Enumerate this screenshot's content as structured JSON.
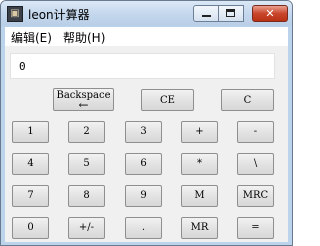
{
  "window": {
    "title": "leon计算器",
    "app_icon_glyph": "▣",
    "minimize_glyph": "",
    "close_glyph": "✕"
  },
  "menu": {
    "edit": "编辑(E)",
    "help": "帮助(H)"
  },
  "display": {
    "value": "0"
  },
  "top_buttons": {
    "backspace": "Backspace",
    "backspace_arrow": "←",
    "ce": "CE",
    "c": "C"
  },
  "keypad": {
    "rows": [
      [
        "1",
        "2",
        "3",
        "+",
        "-"
      ],
      [
        "4",
        "5",
        "6",
        "*",
        "\\"
      ],
      [
        "7",
        "8",
        "9",
        "M",
        "MRC"
      ],
      [
        "0",
        "+/-",
        ".",
        "MR",
        "="
      ]
    ]
  }
}
